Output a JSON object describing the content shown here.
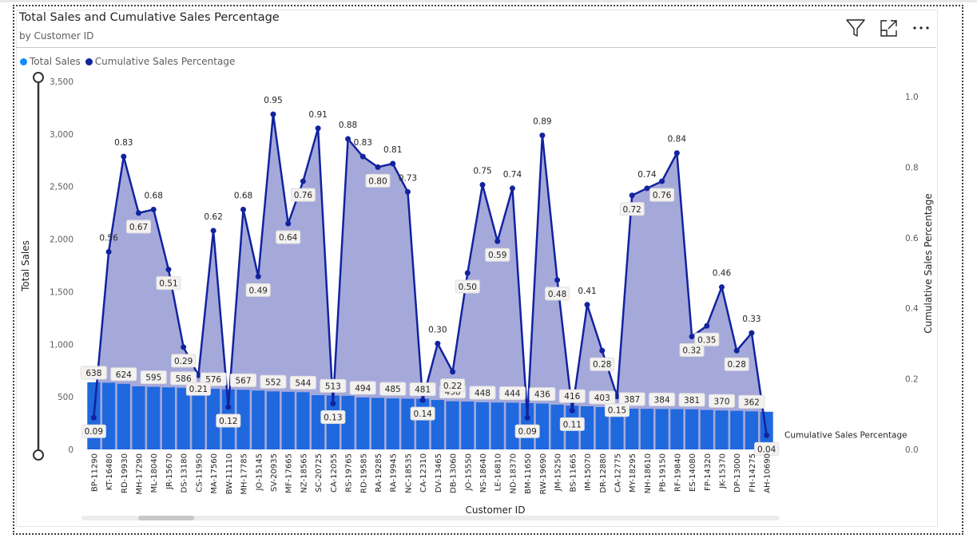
{
  "title": "Total Sales and Cumulative Sales Percentage",
  "subtitle": "by Customer ID",
  "legend": [
    {
      "label": "Total Sales",
      "color": "#118DFF"
    },
    {
      "label": "Cumulative Sales Percentage",
      "color": "#12239E"
    }
  ],
  "icons": [
    "filter-icon",
    "focus-mode-icon",
    "more-options-icon"
  ],
  "chart_data": {
    "type": "bar",
    "xlabel": "Customer ID",
    "ylabel": "Total Sales",
    "y2label": "Cumulative Sales Percentage",
    "ylim": [
      0,
      3500
    ],
    "y2lim": [
      0,
      1.0
    ],
    "yticks": [
      "3,500",
      "3,000",
      "2,500",
      "2,000",
      "1,500",
      "1,000",
      "500",
      "0"
    ],
    "y2ticks": [
      "1.0",
      "0.8",
      "0.6",
      "0.4",
      "0.2",
      "0.0"
    ],
    "end_label": "Cumulative Sales Percentage",
    "categories": [
      "BP-11290",
      "KT-16480",
      "RD-19930",
      "MH-17290",
      "ML-18040",
      "JR-15670",
      "DS-13180",
      "CS-11950",
      "MA-17560",
      "BW-11110",
      "MH-17785",
      "JO-15145",
      "SV-20935",
      "MF-17665",
      "NZ-18565",
      "SC-20725",
      "CA-12055",
      "RS-19765",
      "RD-19585",
      "RA-19285",
      "RA-19945",
      "NC-18535",
      "CA-12310",
      "DV-13465",
      "DB-13060",
      "JO-15550",
      "NS-18640",
      "LE-16810",
      "ND-18370",
      "BM-11650",
      "RW-19690",
      "JM-15250",
      "BS-11665",
      "IM-15070",
      "DR-12880",
      "CA-12775",
      "MY-18295",
      "NH-18610",
      "PB-19150",
      "RF-19840",
      "ES-14080",
      "FP-14320",
      "JK-15370",
      "DP-13000",
      "FH-14275",
      "AH-10690"
    ],
    "series": [
      {
        "name": "Total Sales",
        "type": "bar",
        "color": "#1F68DE",
        "values": [
          638,
          634,
          624,
          600,
          595,
          590,
          586,
          580,
          576,
          571,
          567,
          560,
          552,
          548,
          544,
          516,
          513,
          510,
          494,
          490,
          485,
          483,
          481,
          470,
          458,
          455,
          448,
          446,
          444,
          440,
          436,
          425,
          416,
          410,
          403,
          397,
          387,
          386,
          384,
          383,
          381,
          375,
          370,
          367,
          362,
          358
        ],
        "labels": [
          "638",
          null,
          "624",
          null,
          "595",
          null,
          "586",
          null,
          "576",
          null,
          "567",
          null,
          "552",
          null,
          "544",
          null,
          "513",
          null,
          "494",
          null,
          "485",
          null,
          "481",
          null,
          "458",
          null,
          "448",
          null,
          "444",
          null,
          "436",
          null,
          "416",
          null,
          "403",
          null,
          "387",
          null,
          "384",
          null,
          "381",
          null,
          "370",
          null,
          "362",
          null
        ]
      },
      {
        "name": "Cumulative Sales Percentage",
        "type": "line-area",
        "color": "#12239E",
        "area_color": "#A5A9DA",
        "values": [
          0.09,
          0.56,
          0.83,
          0.67,
          0.68,
          0.51,
          0.29,
          0.21,
          0.62,
          0.12,
          0.68,
          0.49,
          0.95,
          0.64,
          0.76,
          0.91,
          0.13,
          0.88,
          0.83,
          0.8,
          0.81,
          0.73,
          0.14,
          0.3,
          0.22,
          0.5,
          0.75,
          0.59,
          0.74,
          0.09,
          0.89,
          0.48,
          0.11,
          0.41,
          0.28,
          0.15,
          0.72,
          0.74,
          0.76,
          0.84,
          0.32,
          0.35,
          0.46,
          0.28,
          0.33,
          0.04
        ],
        "labels": [
          "0.09",
          "0.56",
          "0.83",
          "0.67",
          "0.68",
          "0.51",
          "0.29",
          "0.21",
          "0.62",
          "0.12",
          "0.68",
          "0.49",
          "0.95",
          "0.64",
          "0.76",
          "0.91",
          "0.13",
          "0.88",
          "0.83",
          "0.80",
          "0.81",
          "0.73",
          "0.14",
          "0.30",
          "0.22",
          "0.50",
          "0.75",
          "0.59",
          "0.74",
          "0.09",
          "0.89",
          "0.48",
          "0.11",
          "0.41",
          "0.28",
          "0.15",
          "0.72",
          "0.74",
          "0.76",
          "0.84",
          "0.32",
          "0.35",
          "0.46",
          "0.28",
          "0.33",
          "0.04"
        ],
        "boxed": [
          true,
          false,
          false,
          true,
          false,
          true,
          true,
          true,
          false,
          true,
          false,
          true,
          false,
          true,
          true,
          false,
          true,
          false,
          false,
          true,
          false,
          false,
          true,
          false,
          true,
          true,
          false,
          true,
          false,
          true,
          false,
          true,
          true,
          false,
          true,
          true,
          true,
          false,
          true,
          false,
          true,
          true,
          false,
          true,
          false,
          true
        ]
      }
    ]
  }
}
